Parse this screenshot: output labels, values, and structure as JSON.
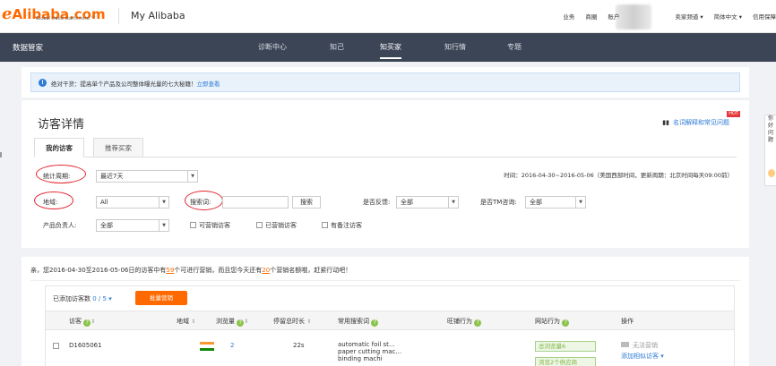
{
  "header": {
    "logo_text": "Alibaba.com",
    "logo_tagline": "Global trade starts here.™",
    "portal_title": "My Alibaba",
    "top_links": [
      "业务",
      "商圈",
      "账户",
      "卖家频道 ▾",
      "简体中文 ▾",
      "信用保障"
    ]
  },
  "nav": {
    "title": "数据管家",
    "tabs": [
      {
        "label": "诊断中心",
        "active": false
      },
      {
        "label": "知己",
        "active": false
      },
      {
        "label": "知买家",
        "active": true
      },
      {
        "label": "知行情",
        "active": false
      },
      {
        "label": "专题",
        "active": false
      }
    ]
  },
  "notice": {
    "icon": "info-icon",
    "text": "绝对干货：提高单个产品及公司整体曝光量的七大秘籍！",
    "link": "立即查看"
  },
  "page": {
    "title": "访客详情",
    "help_link": "名词解释和常见问题",
    "hot_badge": "HOT",
    "tabs": [
      {
        "label": "我的访客",
        "active": true
      },
      {
        "label": "推荐买家",
        "active": false
      }
    ]
  },
  "filters": {
    "period_label": "统计周期:",
    "period_value": "最近7天",
    "time_info": "时间：2016-04-30~2016-05-06（美国西部时间，更新周期：北京时间每天09:00前）",
    "region_label": "地域:",
    "region_value": "All",
    "keyword_label": "搜索词:",
    "keyword_value": "",
    "search_button": "搜索",
    "feedback_label": "是否反馈:",
    "feedback_value": "全部",
    "tm_label": "是否TM咨询:",
    "tm_value": "全部",
    "owner_label": "产品负责人:",
    "owner_value": "全部",
    "checkboxes": [
      "可营销访客",
      "已营销访客",
      "有备注访客"
    ]
  },
  "results": {
    "message_prefix": "亲，您2016-04-30至2016-05-06日的访客中有",
    "message_count1": "59",
    "message_mid": "个可进行营销，而且您今天还有",
    "message_count2": "20",
    "message_suffix": "个营销名额哦，赶紧行动吧！",
    "added_label": "已添加访客数",
    "added_value": "0 / 5",
    "added_arrow": "▾",
    "bulk_button": "批量营销",
    "columns": [
      "访客",
      "地域",
      "浏览量",
      "停留总时长",
      "常用搜索词",
      "旺铺行为",
      "网站行为",
      "操作"
    ],
    "sort_glyph": "⇕",
    "help_glyph": "?",
    "rows": [
      {
        "visitor": "D1605061",
        "flag_colors": [
          "#ff9933",
          "#ffffff",
          "#138808"
        ],
        "views": "2",
        "duration": "22s",
        "keywords": [
          "automatic foil st...",
          "paper cutting mac...",
          "binding machi"
        ],
        "site_behavior": [
          "总浏览量6",
          "浏览2个供应商"
        ],
        "op_primary": "无法营销",
        "op_secondary": "添加相似访客 ▾"
      }
    ]
  },
  "side_widget": [
    "你",
    "好",
    "问",
    "题"
  ]
}
